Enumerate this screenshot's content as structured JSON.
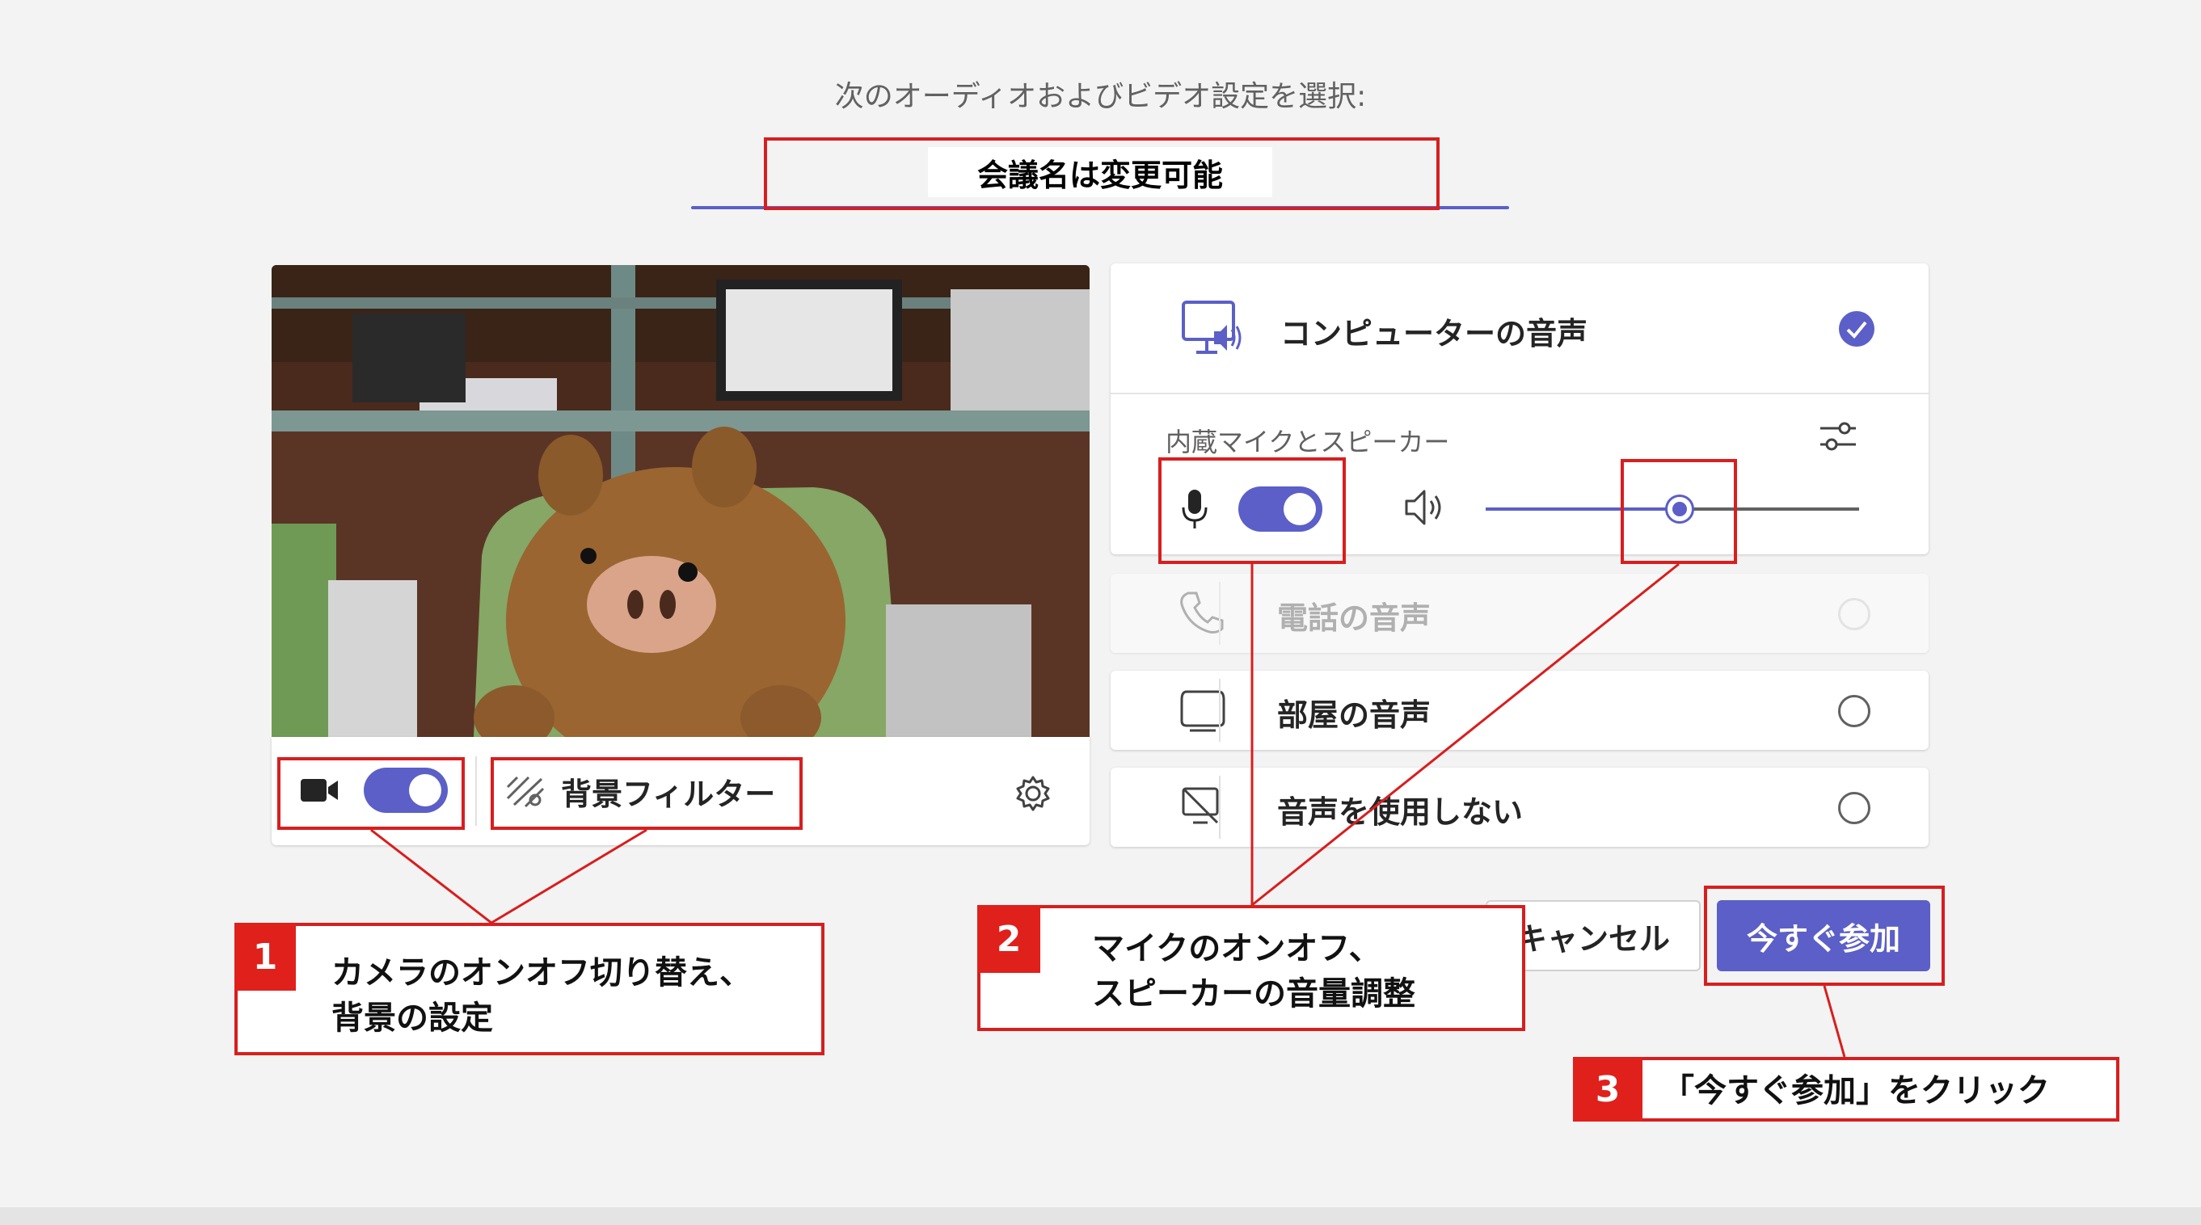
{
  "header": {
    "title": "次のオーディオおよびビデオ設定を選択:",
    "meeting_name": "会議名は変更可能"
  },
  "video_bar": {
    "background_filter": "背景フィルター",
    "camera_on": true
  },
  "audio": {
    "computer": {
      "label": "コンピューターの音声",
      "selected": true
    },
    "device_label": "内蔵マイクとスピーカー",
    "mic_on": true,
    "speaker_volume_pct": 52,
    "phone": {
      "label": "電話の音声"
    },
    "room": {
      "label": "部屋の音声"
    },
    "none": {
      "label": "音声を使用しない"
    }
  },
  "buttons": {
    "cancel": "キャンセル",
    "join": "今すぐ参加"
  },
  "callouts": [
    {
      "num": "1",
      "line1": "カメラのオンオフ切り替え、",
      "line2": "背景の設定"
    },
    {
      "num": "2",
      "line1": "マイクのオンオフ、",
      "line2": "スピーカーの音量調整"
    },
    {
      "num": "3",
      "line1": "「今すぐ参加」をクリック"
    }
  ],
  "colors": {
    "accent": "#5b5fc7",
    "annotation_red": "#d81e1e"
  }
}
